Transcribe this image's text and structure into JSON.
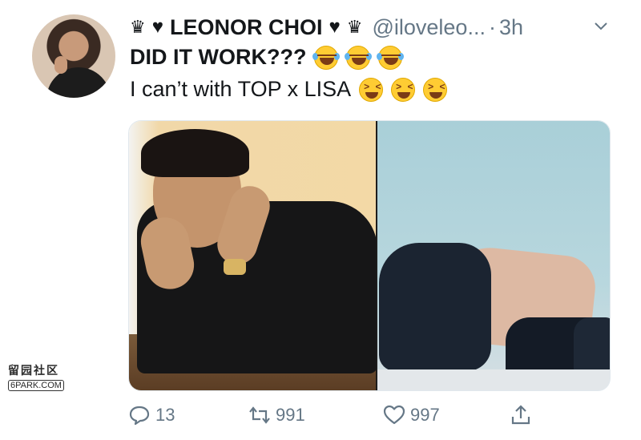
{
  "tweet": {
    "author_name": "LEONOR CHOI",
    "handle": "@iloveleo...",
    "dot": "·",
    "time": "3h",
    "line1": "DID IT WORK???",
    "line2": "I can’t with TOP x LISA",
    "crown_glyph": "♛",
    "heart_glyph": "♥"
  },
  "watermark": {
    "top": "留园社区",
    "bottom": "6PARK.COM"
  },
  "actions": {
    "reply_count": "13",
    "retweet_count": "991",
    "like_count": "997"
  },
  "icons": {
    "menu": "chevron-down-icon",
    "reply": "reply-icon",
    "retweet": "retweet-icon",
    "like": "heart-icon",
    "share": "share-icon"
  },
  "colors": {
    "text": "#14171a",
    "muted": "#657786",
    "emoji": "#ffcc33"
  }
}
